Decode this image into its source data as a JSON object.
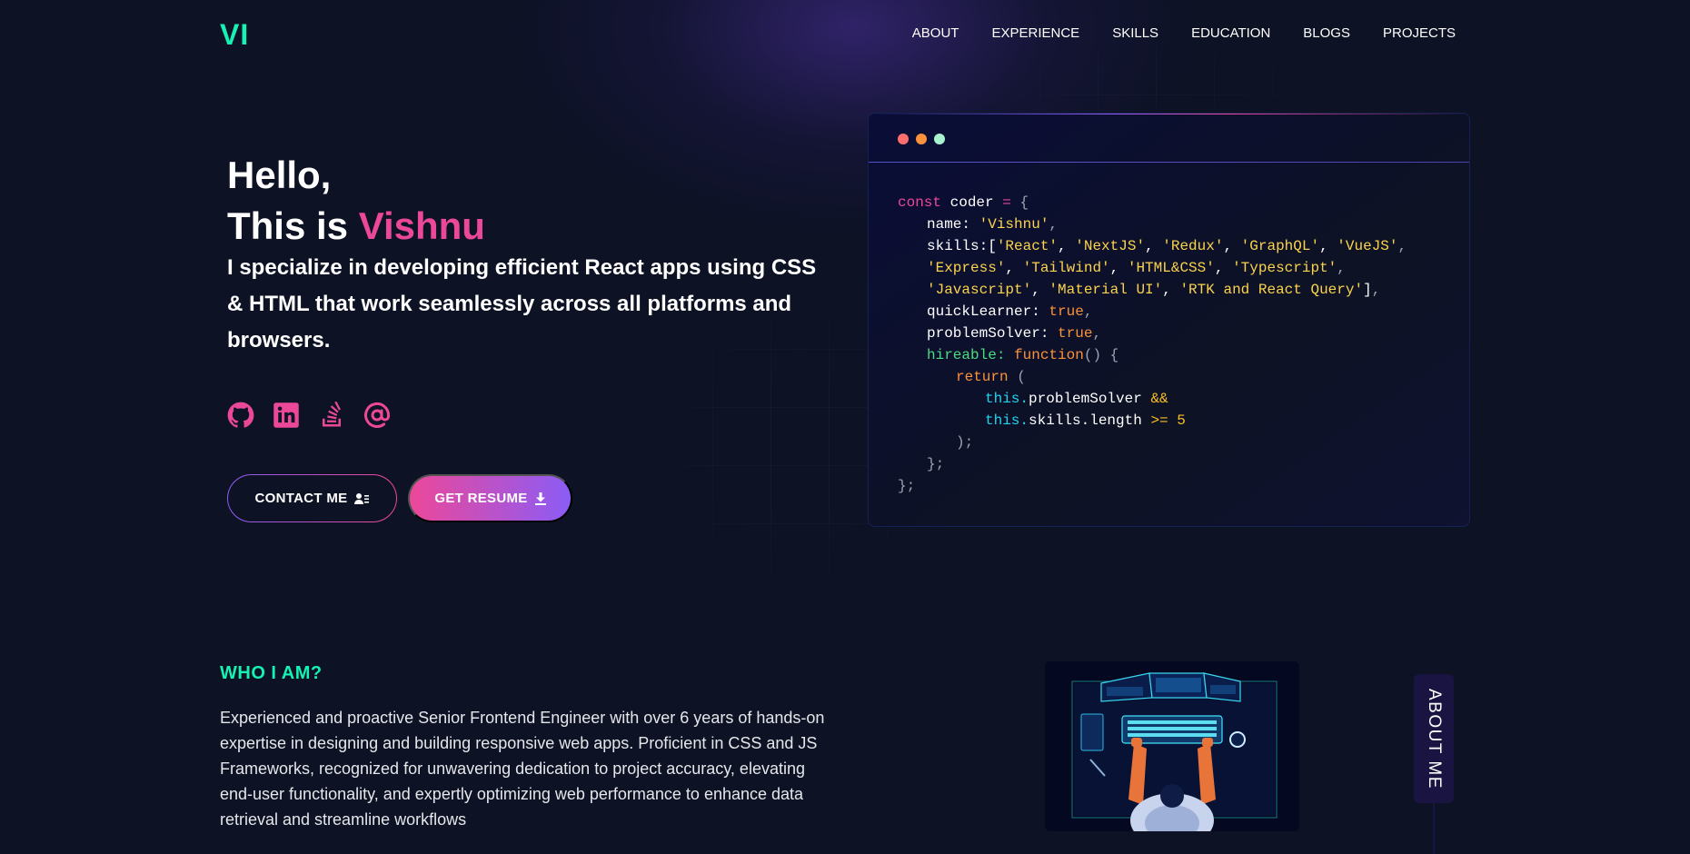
{
  "nav": {
    "logo": "VI",
    "links": [
      "ABOUT",
      "EXPERIENCE",
      "SKILLS",
      "EDUCATION",
      "BLOGS",
      "PROJECTS"
    ]
  },
  "hero": {
    "greeting": "Hello,",
    "intro_prefix": "This is ",
    "name": "Vishnu",
    "subtitle": "I specialize in developing efficient React apps using CSS & HTML that work seamlessly across all platforms and browsers.",
    "socials": [
      "github-icon",
      "linkedin-icon",
      "stackoverflow-icon",
      "at-sign-icon"
    ],
    "contact_label": "CONTACT ME",
    "resume_label": "GET RESUME"
  },
  "code_card": {
    "window_dots": [
      "#ff6e6e",
      "#fb923c",
      "#a7f3d0"
    ],
    "lines": [
      "const coder = {",
      "name: 'Vishnu',",
      "skills:['React', 'NextJS', 'Redux', 'GraphQL', 'VueJS',",
      "'Express', 'Tailwind', 'HTML&CSS', 'Typescript',",
      "'Javascript', 'Material UI', 'RTK and React Query'],",
      "quickLearner: true,",
      "problemSolver: true,",
      "hireable: function() {",
      "return (",
      "this.problemSolver &&",
      "this.skills.length >= 5",
      ");",
      "};",
      "};"
    ]
  },
  "about": {
    "heading": "WHO I AM?",
    "text": "Experienced and proactive Senior Frontend Engineer with over 6 years of hands-on expertise in designing and building responsive web apps. Proficient in CSS and JS Frameworks, recognized for unwavering dedication to project accuracy, elevating end-user functionality, and expertly optimizing web performance to enhance data retrieval and streamline workflows",
    "side_tab": "ABOUT ME"
  },
  "colors": {
    "background": "#0d1224",
    "accent_green": "#16f2b3",
    "accent_pink": "#ec4899",
    "accent_violet": "#8b5cf6"
  }
}
